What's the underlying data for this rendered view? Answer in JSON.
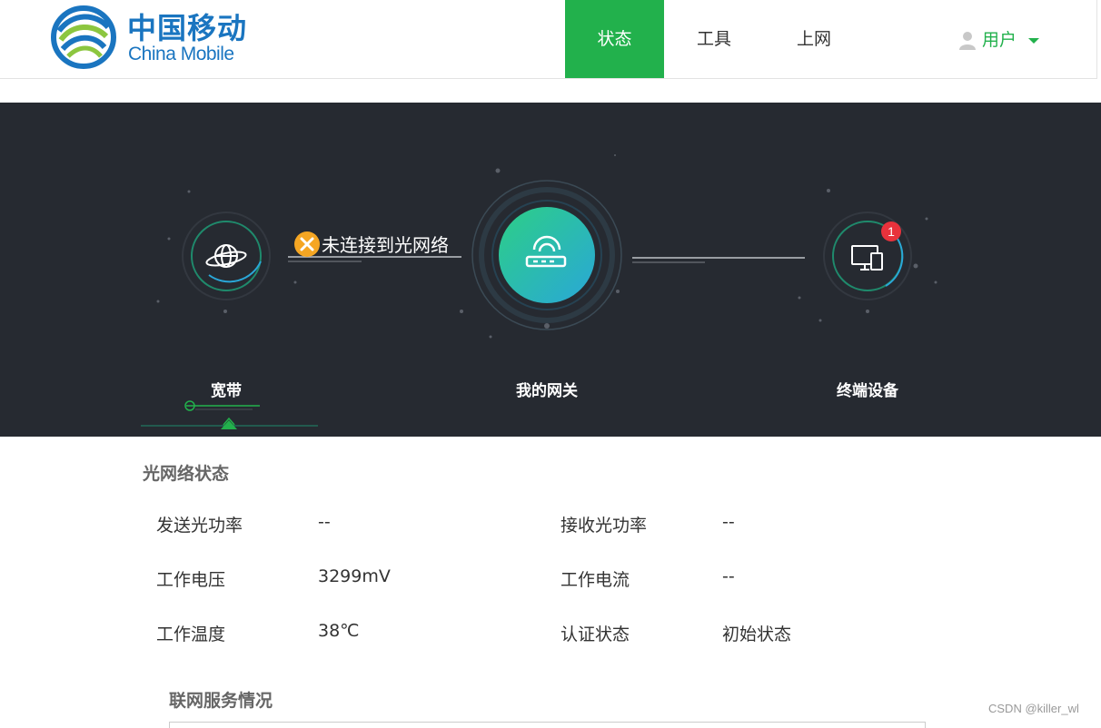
{
  "brand": {
    "name_cn": "中国移动",
    "name_en": "China Mobile"
  },
  "nav": {
    "items": [
      {
        "label": "状态",
        "active": true
      },
      {
        "label": "工具",
        "active": false
      },
      {
        "label": "上网",
        "active": false
      }
    ],
    "user_label": "用户"
  },
  "topology": {
    "broadband_label": "宽带",
    "gateway_label": "我的网关",
    "devices_label": "终端设备",
    "connection_status": "未连接到光网络",
    "device_badge": "1",
    "colors": {
      "accent": "#22b14c",
      "warning": "#f5a623",
      "badge": "#e8323c",
      "banner_bg": "#262a31"
    }
  },
  "optical_status": {
    "title": "光网络状态",
    "rows": [
      {
        "label_left": "发送光功率",
        "value_left": "--",
        "label_right": "接收光功率",
        "value_right": "--"
      },
      {
        "label_left": "工作电压",
        "value_left": "3299mV",
        "label_right": "工作电流",
        "value_right": "--"
      },
      {
        "label_left": "工作温度",
        "value_left": "38℃",
        "label_right": "认证状态",
        "value_right": "初始状态"
      }
    ]
  },
  "service": {
    "title": "联网服务情况"
  },
  "watermark": "CSDN @killer_wl"
}
